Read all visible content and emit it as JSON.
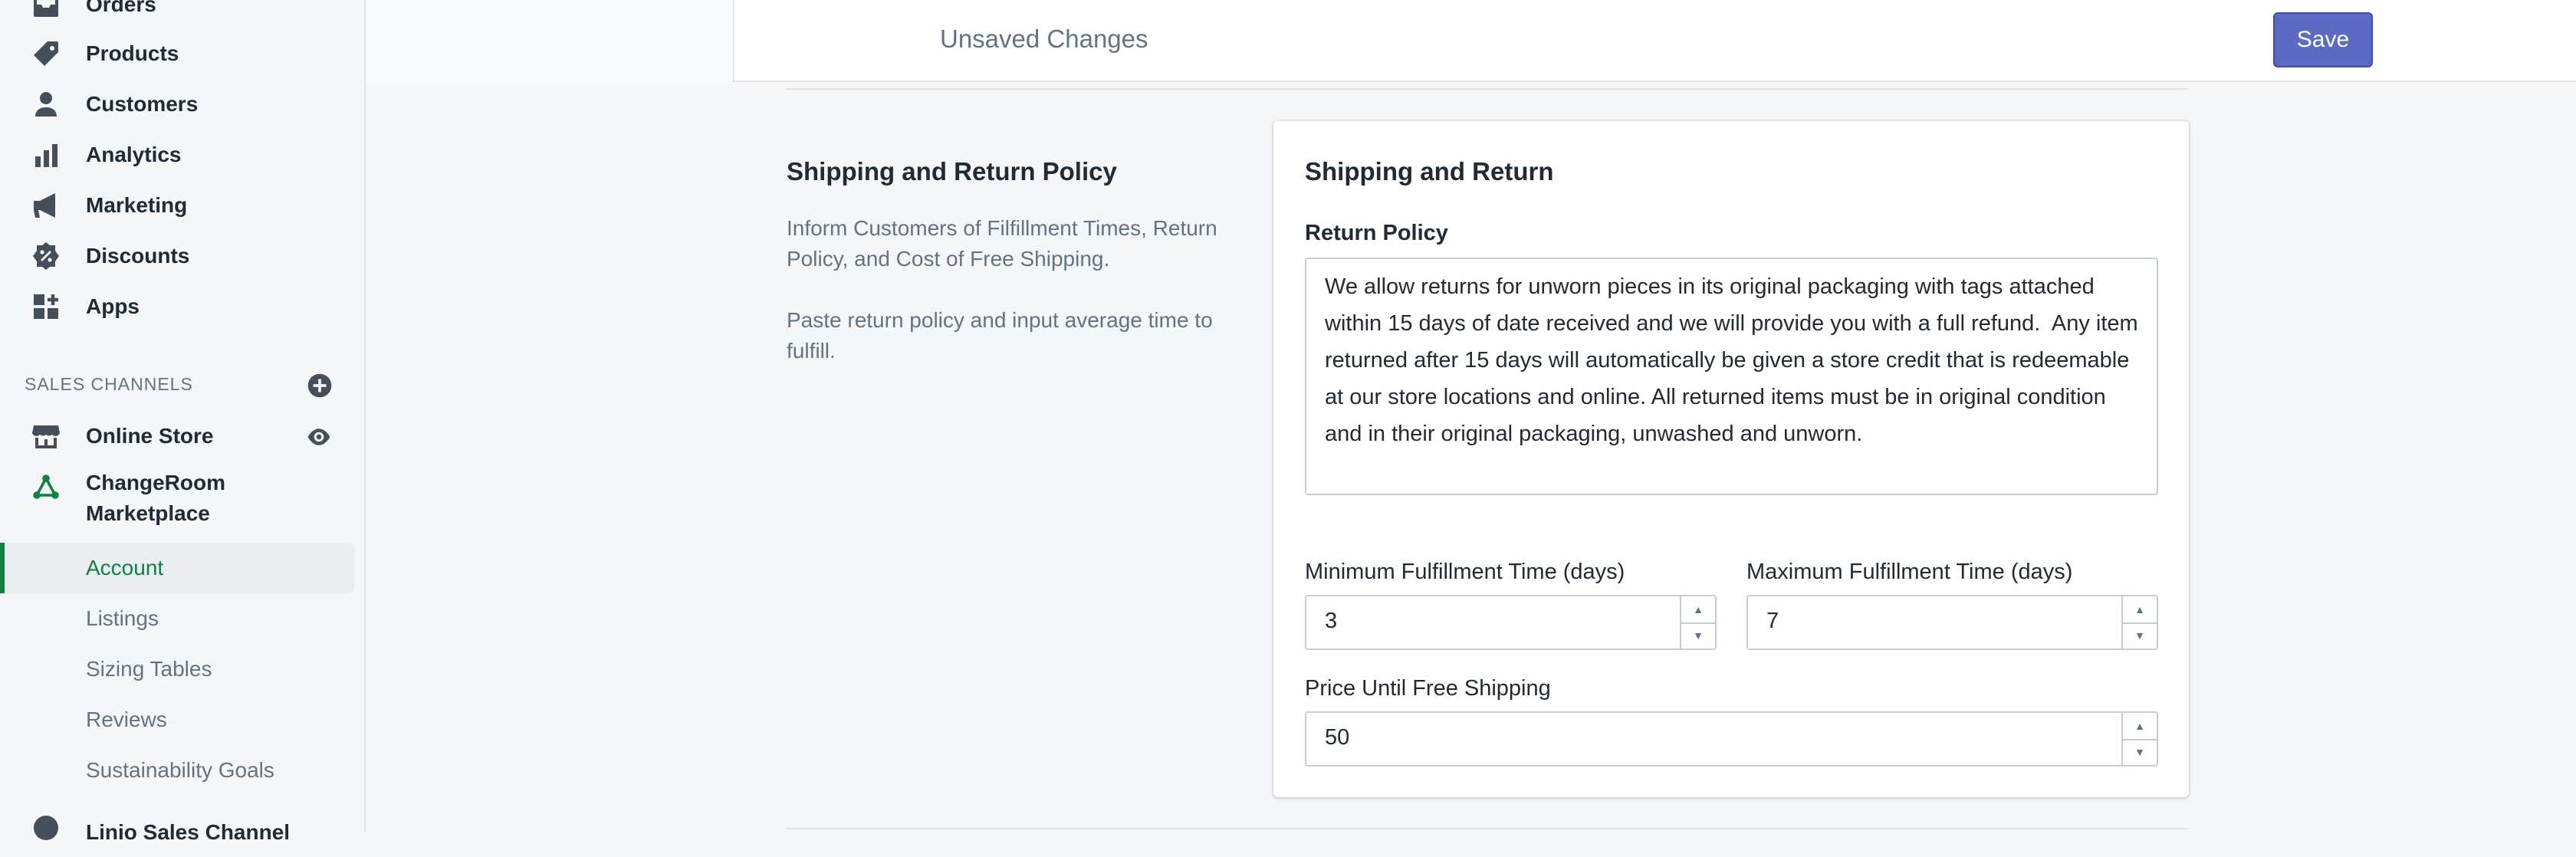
{
  "sidebar": {
    "items": [
      {
        "label": "Orders",
        "icon": "orders-icon"
      },
      {
        "label": "Products",
        "icon": "tag-icon"
      },
      {
        "label": "Customers",
        "icon": "person-icon"
      },
      {
        "label": "Analytics",
        "icon": "bar-chart-icon"
      },
      {
        "label": "Marketing",
        "icon": "megaphone-icon"
      },
      {
        "label": "Discounts",
        "icon": "discount-badge-icon"
      },
      {
        "label": "Apps",
        "icon": "apps-grid-icon"
      }
    ],
    "sales_channels_label": "SALES CHANNELS",
    "channels": {
      "online_store": "Online Store",
      "changeroom_line1": "ChangeRoom",
      "changeroom_line2": "Marketplace",
      "linio": "Linio Sales Channel"
    },
    "subitems": [
      "Account",
      "Listings",
      "Sizing Tables",
      "Reviews",
      "Sustainability Goals"
    ]
  },
  "topbar": {
    "unsaved": "Unsaved Changes",
    "save": "Save"
  },
  "annotated": {
    "title": "Shipping and Return Policy",
    "desc1": "Inform Customers of Filfillment Times, Return Policy, and Cost of Free Shipping.",
    "desc2": "Paste return policy and input average time to fulfill."
  },
  "card": {
    "title": "Shipping and Return",
    "return_policy_label": "Return Policy",
    "return_policy_value": "We allow returns for unworn pieces in its original packaging with tags attached within 15 days of date received and we will provide you with a full refund.  Any item returned after 15 days will automatically be given a store credit that is redeemable at our store locations and online. All returned items must be in original condition and in their original packaging, unwashed and unworn.",
    "min_label": "Minimum Fulfillment Time (days)",
    "min_value": "3",
    "max_label": "Maximum Fulfillment Time (days)",
    "max_value": "7",
    "price_label": "Price Until Free Shipping",
    "price_value": "50"
  },
  "colors": {
    "accent": "#5c6ac4",
    "active_green": "#108043",
    "text": "#212b36",
    "subdued": "#637381"
  }
}
